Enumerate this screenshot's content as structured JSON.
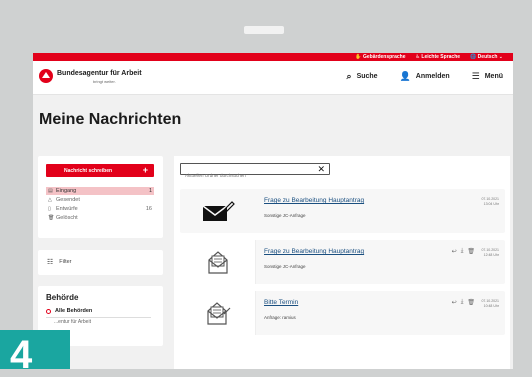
{
  "topbar": {
    "sign_language": "Gebärdensprache",
    "easy_language": "Leichte Sprache",
    "language": "Deutsch"
  },
  "header": {
    "brand": "Bundesagentur für Arbeit",
    "tagline": "bringt weiter.",
    "search_label": "Suche",
    "login_label": "Anmelden",
    "menu_label": "Menü"
  },
  "page": {
    "title": "Meine Nachrichten"
  },
  "sidebar": {
    "write_button": "Nachricht schreiben",
    "folders": [
      {
        "label": "Eingang",
        "count": "1"
      },
      {
        "label": "Gesendet",
        "count": ""
      },
      {
        "label": "Entwürfe",
        "count": "16"
      },
      {
        "label": "Gelöscht",
        "count": ""
      }
    ],
    "filter_label": "Filter",
    "authorities_title": "Behörde",
    "all_authorities": "Alle Behörden",
    "authority_item": "...entur für Arbeit"
  },
  "search": {
    "placeholder": "Aktuellen Ordner durchsuchen"
  },
  "messages": [
    {
      "title": "Frage zu Bearbeitung Hauptantrag",
      "subtitle": "Sonstige JC-Anfrage",
      "date": "07.10.2021\n13:04 Uhr"
    },
    {
      "title": "Frage zu Bearbeitung Hauptantrag",
      "subtitle": "Sonstige JC-Anfrage",
      "date": "07.10.2021\n12:48 Uhr"
    },
    {
      "title": "Bitte Termin",
      "subtitle": "Anfrage: ramius",
      "date": "07.10.2021\n10:48 Uhr"
    }
  ],
  "step_badge": "4",
  "colors": {
    "brand_red": "#e2001a",
    "badge_teal": "#1aa6a0",
    "link_blue": "#1a4f80",
    "active_folder": "#f4c2c6"
  }
}
